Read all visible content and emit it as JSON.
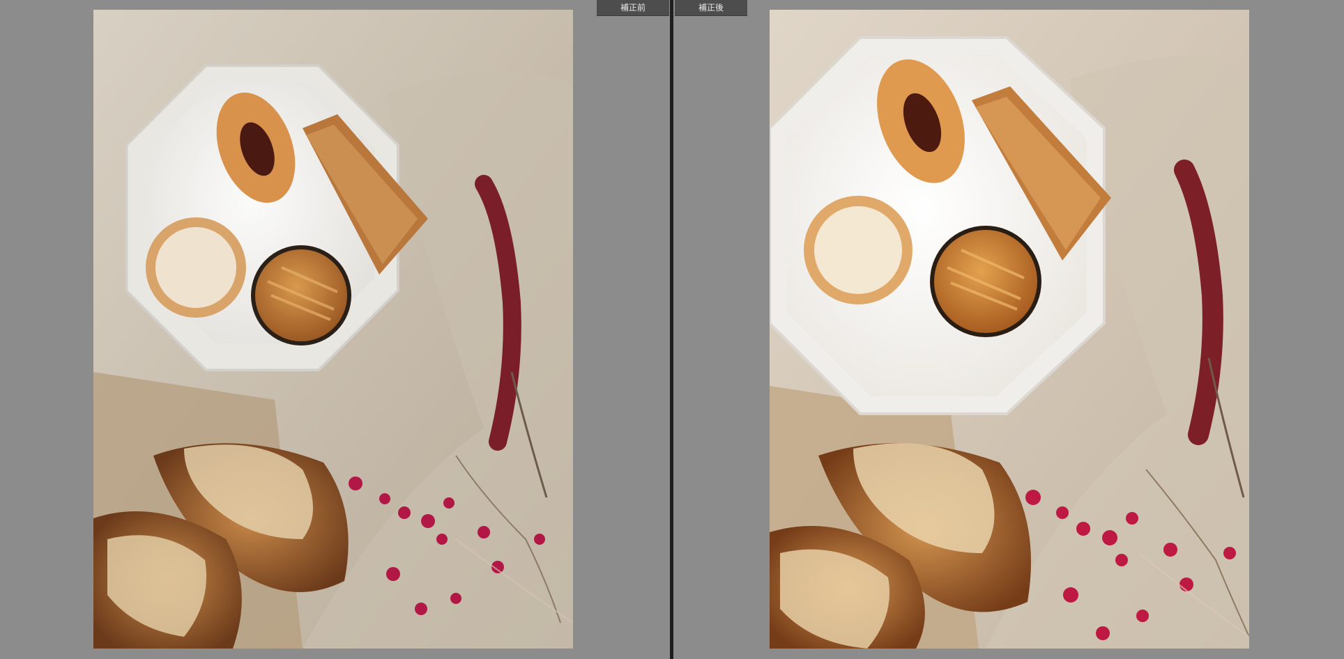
{
  "compare_view": {
    "before_label": "補正前",
    "after_label": "補正後"
  },
  "photo": {
    "subject": "pastry-plate-photo",
    "before_tone": "cool",
    "after_tone": "warm"
  },
  "colors": {
    "background": "#8c8c8c",
    "divider": "#1f1f1f",
    "label_bg": "#4d4d4d",
    "label_text": "#e8e8e8"
  }
}
